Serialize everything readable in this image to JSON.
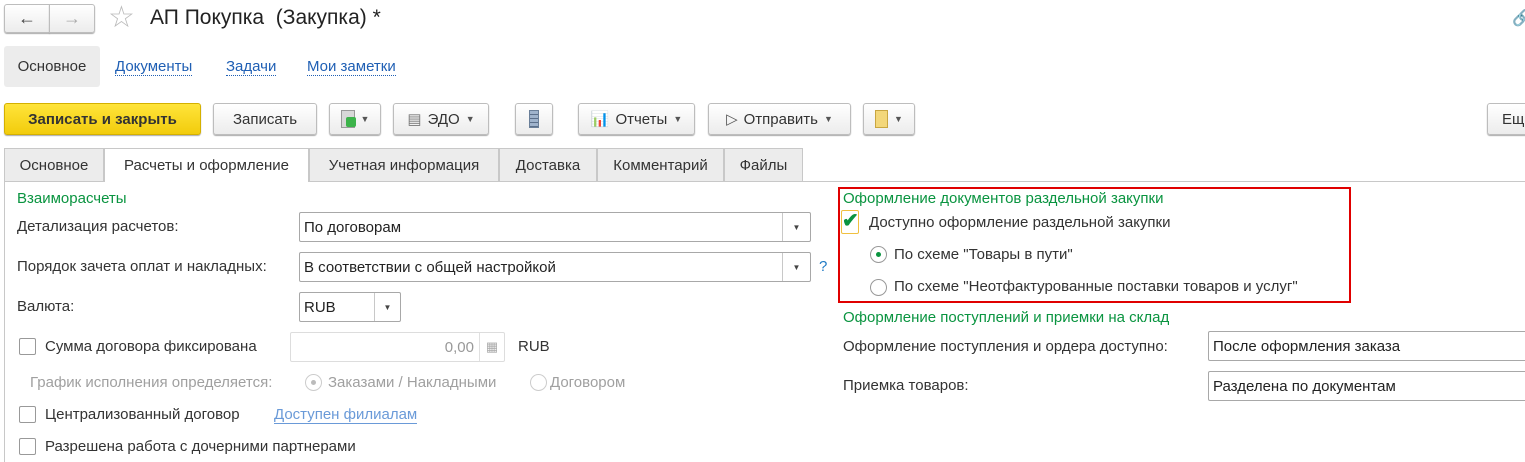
{
  "window": {
    "title": "АП Покупка  (Закупка) *",
    "back_icon": "arrow-left-icon",
    "forward_icon": "arrow-right-icon",
    "favorite_icon": "star-icon",
    "link_icon": "link-icon"
  },
  "nav": {
    "items": [
      {
        "label": "Основное"
      },
      {
        "label": "Документы"
      },
      {
        "label": "Задачи"
      },
      {
        "label": "Мои заметки"
      }
    ]
  },
  "toolbar": {
    "save_close": "Записать и закрыть",
    "save": "Записать",
    "edo": "ЭДО",
    "reports": "Отчеты",
    "send": "Отправить",
    "more": "Ещ",
    "accent": "#f5d21d"
  },
  "tabs": [
    {
      "label": "Основное"
    },
    {
      "label": "Расчеты и оформление"
    },
    {
      "label": "Учетная информация"
    },
    {
      "label": "Доставка"
    },
    {
      "label": "Комментарий"
    },
    {
      "label": "Файлы"
    }
  ],
  "settlements": {
    "header": "Взаиморасчеты",
    "detail_label": "Детализация расчетов:",
    "detail_value": "По договорам",
    "order_label": "Порядок зачета оплат и накладных:",
    "order_value": "В соответствии с общей настройкой",
    "help": "?",
    "currency_label": "Валюта:",
    "currency_value": "RUB",
    "fixed_sum_label": "Сумма договора фиксирована",
    "fixed_sum_checked": false,
    "fixed_sum_value": "0,00",
    "fixed_sum_currency": "RUB",
    "schedule_label": "График исполнения определяется:",
    "schedule_opt1": "Заказами / Накладными",
    "schedule_opt2": "Договором",
    "schedule_selected": "Заказами / Накладными",
    "centralized_label": "Централизованный договор",
    "centralized_checked": false,
    "branches_link": "Доступен филиалам",
    "child_partners_label": "Разрешена работа с дочерними партнерами",
    "child_partners_checked": false
  },
  "separate_purchase": {
    "header": "Оформление документов раздельной закупки",
    "available_label": "Доступно оформление раздельной закупки",
    "available_checked": true,
    "scheme1": "По схеме \"Товары в пути\"",
    "scheme2": "По схеме \"Неотфактурованные поставки товаров и услуг\"",
    "selected": "По схеме \"Товары в пути\"",
    "highlight_color": "#e00000"
  },
  "receipts": {
    "header": "Оформление поступлений и приемки на склад",
    "receipt_label": "Оформление поступления и ордера доступно:",
    "receipt_value": "После оформления заказа",
    "acceptance_label": "Приемка товаров:",
    "acceptance_value": "Разделена по документам"
  }
}
